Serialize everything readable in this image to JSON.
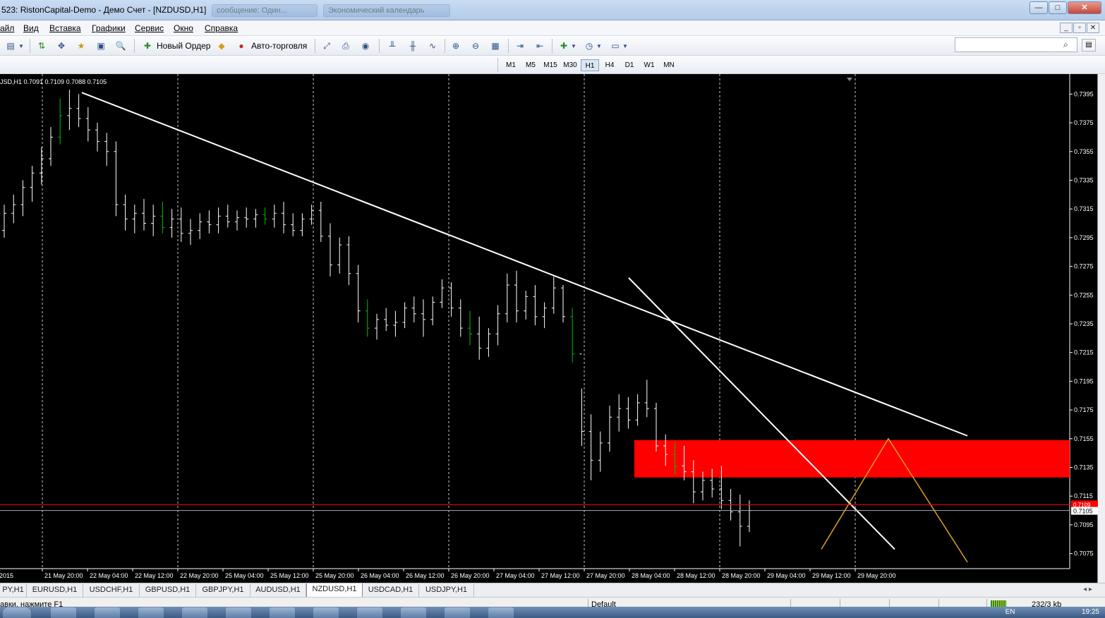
{
  "window": {
    "title": "523: RistonCapital-Demo - Демо Счет - [NZDUSD,H1]",
    "ghost_tabs": [
      "сообщение: Один...",
      "Экономический календарь"
    ],
    "controls": {
      "minimize": "—",
      "maximize": "□",
      "close": "✕"
    }
  },
  "menu": {
    "items": [
      "айл",
      "Вид",
      "Вставка",
      "Графики",
      "Сервис",
      "Окно",
      "Справка"
    ],
    "mdi_controls": [
      "_",
      "▫",
      "✕"
    ]
  },
  "toolbar1": {
    "new_order_label": "Новый Ордер",
    "autotrading_label": "Авто-торговля"
  },
  "toolbar2": {
    "timeframes": [
      "M1",
      "M5",
      "M15",
      "M30",
      "H1",
      "H4",
      "D1",
      "W1",
      "MN"
    ],
    "active_timeframe": "H1"
  },
  "search": {
    "placeholder": ""
  },
  "chart": {
    "ohlc_label": "JSD,H1  0.7091 0.7109 0.7088 0.7105",
    "current_price_label": "0.7105",
    "ask_label": "0.7109",
    "bg_color": "#000000",
    "bar_up_color": "#00c000",
    "bar_color": "#ffffff",
    "trendline_color": "#ffffff",
    "zone_color": "#ff0000",
    "projection_color": "#e0a020",
    "ask_line_color": "#ff0000"
  },
  "chart_data": {
    "type": "ohlc",
    "symbol": "NZDUSD",
    "timeframe": "H1",
    "ylim": [
      0.7065,
      0.7405
    ],
    "y_ticks": [
      "0.7395",
      "0.7375",
      "0.7355",
      "0.7335",
      "0.7315",
      "0.7295",
      "0.7275",
      "0.7255",
      "0.7235",
      "0.7215",
      "0.7195",
      "0.7175",
      "0.7155",
      "0.7135",
      "0.7115",
      "0.7095",
      "0.7075"
    ],
    "x_ticks": [
      "2015",
      "21 May 20:00",
      "22 May 04:00",
      "22 May 12:00",
      "22 May 20:00",
      "25 May 04:00",
      "25 May 12:00",
      "25 May 20:00",
      "26 May 04:00",
      "26 May 12:00",
      "26 May 20:00",
      "27 May 04:00",
      "27 May 12:00",
      "27 May 20:00",
      "28 May 04:00",
      "28 May 12:00",
      "28 May 20:00",
      "29 May 04:00",
      "29 May 12:00",
      "29 May 20:00"
    ],
    "bars": [
      [
        0.73,
        0.7318,
        0.7295,
        0.7312
      ],
      [
        0.7312,
        0.7325,
        0.7305,
        0.7318
      ],
      [
        0.7318,
        0.7335,
        0.731,
        0.733
      ],
      [
        0.733,
        0.7345,
        0.732,
        0.734
      ],
      [
        0.734,
        0.7358,
        0.7332,
        0.735
      ],
      [
        0.735,
        0.7372,
        0.7345,
        0.7365
      ],
      [
        0.7365,
        0.7392,
        0.736,
        0.738
      ],
      [
        0.738,
        0.7398,
        0.737,
        0.7385
      ],
      [
        0.7385,
        0.7395,
        0.7372,
        0.7378
      ],
      [
        0.7378,
        0.7386,
        0.7362,
        0.737
      ],
      [
        0.737,
        0.7375,
        0.7355,
        0.7362
      ],
      [
        0.7362,
        0.7368,
        0.7345,
        0.7355
      ],
      [
        0.7355,
        0.7362,
        0.731,
        0.7318
      ],
      [
        0.7318,
        0.7325,
        0.73,
        0.7308
      ],
      [
        0.7308,
        0.7318,
        0.7298,
        0.7312
      ],
      [
        0.7312,
        0.7322,
        0.73,
        0.7305
      ],
      [
        0.7305,
        0.7318,
        0.7296,
        0.731
      ],
      [
        0.731,
        0.732,
        0.7298,
        0.7302
      ],
      [
        0.7302,
        0.7315,
        0.7295,
        0.7308
      ],
      [
        0.7308,
        0.7316,
        0.7292,
        0.7298
      ],
      [
        0.7298,
        0.7308,
        0.729,
        0.73
      ],
      [
        0.73,
        0.7312,
        0.7294,
        0.7306
      ],
      [
        0.7306,
        0.7314,
        0.7298,
        0.7304
      ],
      [
        0.7304,
        0.7316,
        0.7298,
        0.731
      ],
      [
        0.731,
        0.7318,
        0.7302,
        0.7306
      ],
      [
        0.7306,
        0.7314,
        0.73,
        0.7309
      ],
      [
        0.7309,
        0.7316,
        0.7302,
        0.7308
      ],
      [
        0.7308,
        0.7315,
        0.7302,
        0.7311
      ],
      [
        0.7311,
        0.7316,
        0.7304,
        0.7308
      ],
      [
        0.7308,
        0.7318,
        0.7302,
        0.7312
      ],
      [
        0.7312,
        0.732,
        0.7298,
        0.7304
      ],
      [
        0.7304,
        0.7312,
        0.7296,
        0.73
      ],
      [
        0.73,
        0.7312,
        0.7296,
        0.7308
      ],
      [
        0.7308,
        0.7318,
        0.7304,
        0.7314
      ],
      [
        0.7314,
        0.732,
        0.7292,
        0.7296
      ],
      [
        0.7296,
        0.7305,
        0.7268,
        0.7276
      ],
      [
        0.7276,
        0.7295,
        0.727,
        0.729
      ],
      [
        0.729,
        0.7296,
        0.7262,
        0.727
      ],
      [
        0.727,
        0.7276,
        0.7236,
        0.7244
      ],
      [
        0.7244,
        0.7252,
        0.7226,
        0.7232
      ],
      [
        0.7232,
        0.7242,
        0.7224,
        0.7238
      ],
      [
        0.7238,
        0.7246,
        0.723,
        0.7234
      ],
      [
        0.7234,
        0.7244,
        0.7226,
        0.7236
      ],
      [
        0.7236,
        0.725,
        0.7232,
        0.7246
      ],
      [
        0.7246,
        0.7254,
        0.7236,
        0.7242
      ],
      [
        0.7242,
        0.7252,
        0.7226,
        0.7238
      ],
      [
        0.7238,
        0.7254,
        0.7234,
        0.725
      ],
      [
        0.725,
        0.7266,
        0.7246,
        0.726
      ],
      [
        0.726,
        0.7264,
        0.724,
        0.7246
      ],
      [
        0.7246,
        0.7252,
        0.7226,
        0.7232
      ],
      [
        0.7232,
        0.7244,
        0.722,
        0.7228
      ],
      [
        0.7228,
        0.724,
        0.721,
        0.7218
      ],
      [
        0.7218,
        0.7232,
        0.7212,
        0.7228
      ],
      [
        0.7228,
        0.7248,
        0.722,
        0.7242
      ],
      [
        0.7242,
        0.727,
        0.7236,
        0.7262
      ],
      [
        0.7262,
        0.7272,
        0.7236,
        0.7244
      ],
      [
        0.7244,
        0.7258,
        0.7238,
        0.7254
      ],
      [
        0.7254,
        0.7262,
        0.7234,
        0.724
      ],
      [
        0.724,
        0.725,
        0.7232,
        0.7246
      ],
      [
        0.7246,
        0.7268,
        0.7242,
        0.726
      ],
      [
        0.726,
        0.7262,
        0.7236,
        0.724
      ],
      [
        0.724,
        0.7246,
        0.7208,
        0.7214
      ],
      [
        0.7214,
        0.719,
        0.715,
        0.716
      ],
      [
        0.716,
        0.7172,
        0.7126,
        0.714
      ],
      [
        0.714,
        0.716,
        0.7132,
        0.7152
      ],
      [
        0.7152,
        0.7178,
        0.7146,
        0.717
      ],
      [
        0.717,
        0.7186,
        0.716,
        0.7176
      ],
      [
        0.7176,
        0.7184,
        0.7162,
        0.7168
      ],
      [
        0.7168,
        0.7186,
        0.7164,
        0.718
      ],
      [
        0.718,
        0.7196,
        0.717,
        0.7176
      ],
      [
        0.7176,
        0.718,
        0.7146,
        0.715
      ],
      [
        0.715,
        0.7158,
        0.7136,
        0.7144
      ],
      [
        0.7144,
        0.7152,
        0.713,
        0.7136
      ],
      [
        0.7136,
        0.715,
        0.7126,
        0.7132
      ],
      [
        0.7132,
        0.714,
        0.711,
        0.7118
      ],
      [
        0.7118,
        0.7132,
        0.7112,
        0.7126
      ],
      [
        0.7126,
        0.7134,
        0.7114,
        0.712
      ],
      [
        0.712,
        0.7136,
        0.7106,
        0.7112
      ],
      [
        0.7112,
        0.712,
        0.7098,
        0.7104
      ],
      [
        0.7104,
        0.7116,
        0.708,
        0.7094
      ],
      [
        0.7094,
        0.7112,
        0.709,
        0.7105
      ]
    ],
    "trendlines": [
      {
        "from": [
          "22 May 04:00",
          0.7396
        ],
        "to": [
          "29 May 20:00+",
          0.7157
        ]
      },
      {
        "from": [
          "28 May 04:00",
          0.7266
        ],
        "to": [
          "29 May 20:00",
          0.7078
        ]
      }
    ],
    "zone": {
      "top": 0.7154,
      "bottom": 0.7128
    },
    "current_price": 0.7105,
    "ask_price": 0.7109
  },
  "symbol_tabs": [
    "PY,H1",
    "EURUSD,H1",
    "USDCHF,H1",
    "GBPUSD,H1",
    "GBPJPY,H1",
    "AUDUSD,H1",
    "NZDUSD,H1",
    "USDCAD,H1",
    "USDJPY,H1"
  ],
  "active_symbol_tab": "NZDUSD,H1",
  "status": {
    "help_text": "авки, нажмите F1",
    "profile": "Default",
    "traffic": "232/3 kb"
  },
  "taskbar": {
    "lang": "EN",
    "clock": "19:25"
  }
}
